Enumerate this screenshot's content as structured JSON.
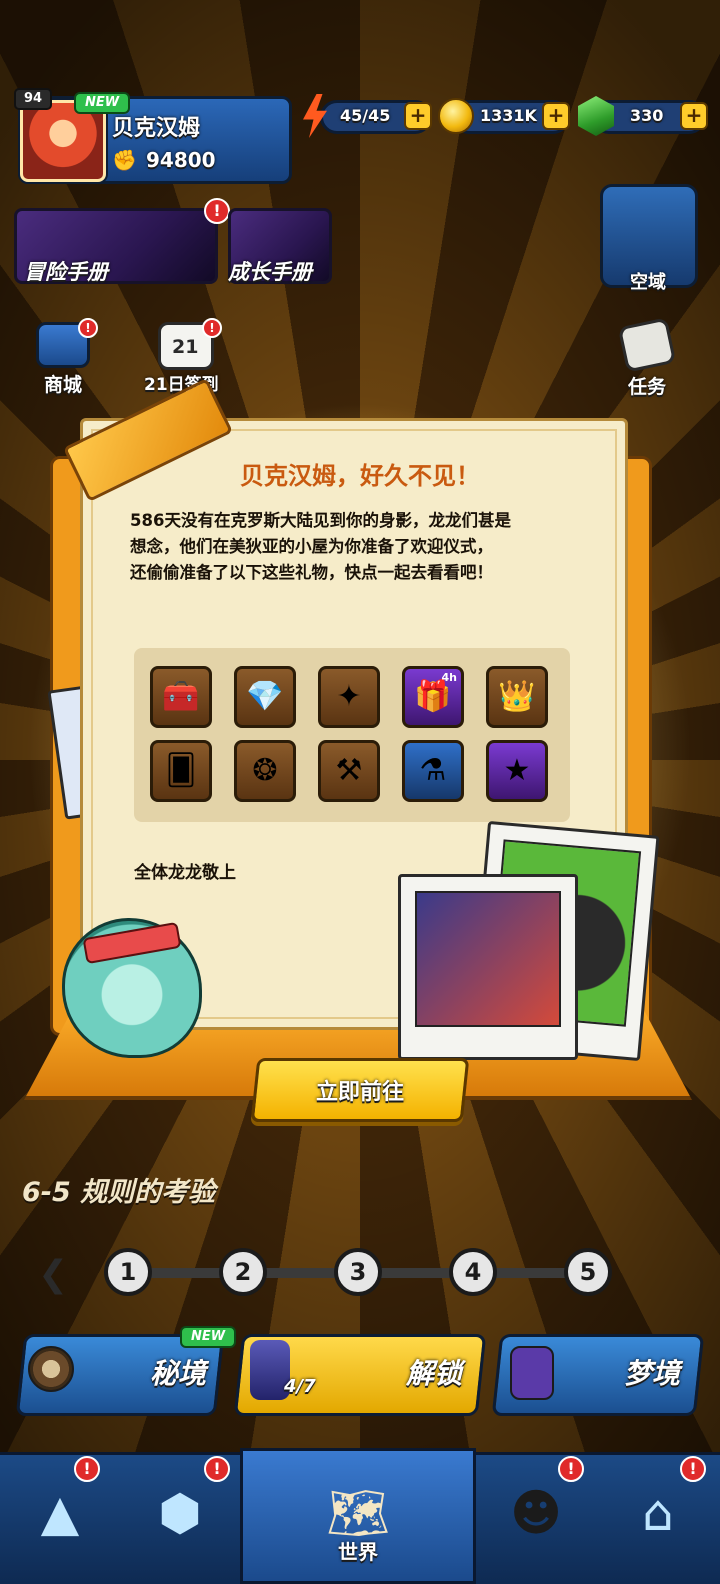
{
  "hud": {
    "level": "94",
    "new_badge": "NEW",
    "player_name": "贝克汉姆",
    "power": "94800",
    "energy": "45/45",
    "coins": "1331K",
    "gems": "330",
    "plus": "+"
  },
  "left_menu": {
    "adventure_manual": "冒险手册",
    "growth_manual": "成长手册",
    "shop": "商城",
    "signin_day": "21",
    "signin": "21日签到"
  },
  "right_menu": {
    "skyfield": "空域",
    "tasks": "任务"
  },
  "alert_mark": "!",
  "popup": {
    "title": "贝克汉姆，好久不见！",
    "message": "586天没有在克罗斯大陆见到你的身影，龙龙们甚是\n想念，他们在美狄亚的小屋为你准备了欢迎仪式，\n还偷偷准备了以下这些礼物，快点一起去看看吧！",
    "signoff": "全体龙龙敬上",
    "cta": "立即前往",
    "rewards": [
      {
        "icon": "treasure-chest-icon",
        "glyph": "🧰",
        "tier": "bronze"
      },
      {
        "icon": "green-gems-icon",
        "glyph": "💎",
        "tier": "bronze"
      },
      {
        "icon": "star-shard-icon",
        "glyph": "✦",
        "tier": "bronze"
      },
      {
        "icon": "timed-chest-icon",
        "glyph": "🎁",
        "tier": "purple",
        "timer": "4h"
      },
      {
        "icon": "crown-card-icon",
        "glyph": "👑",
        "tier": "bronze"
      },
      {
        "icon": "skin-card-icon",
        "glyph": "🂠",
        "tier": "bronze"
      },
      {
        "icon": "golden-pinecone-icon",
        "glyph": "❂",
        "tier": "bronze"
      },
      {
        "icon": "hammer-icon",
        "glyph": "⚒",
        "tier": "bronze"
      },
      {
        "icon": "potion-icon",
        "glyph": "⚗",
        "tier": "blue"
      },
      {
        "icon": "gold-star-icon",
        "glyph": "★",
        "tier": "purple"
      }
    ]
  },
  "stage": {
    "title": "6-5 规则的考验",
    "nodes": [
      "1",
      "2",
      "3",
      "4",
      "5"
    ]
  },
  "modes": {
    "secret_realm": "秘境",
    "secret_realm_badge": "NEW",
    "unlock_progress": "4/7",
    "unlock": "解锁",
    "dreamland": "梦境"
  },
  "nav": {
    "world": "世界"
  }
}
